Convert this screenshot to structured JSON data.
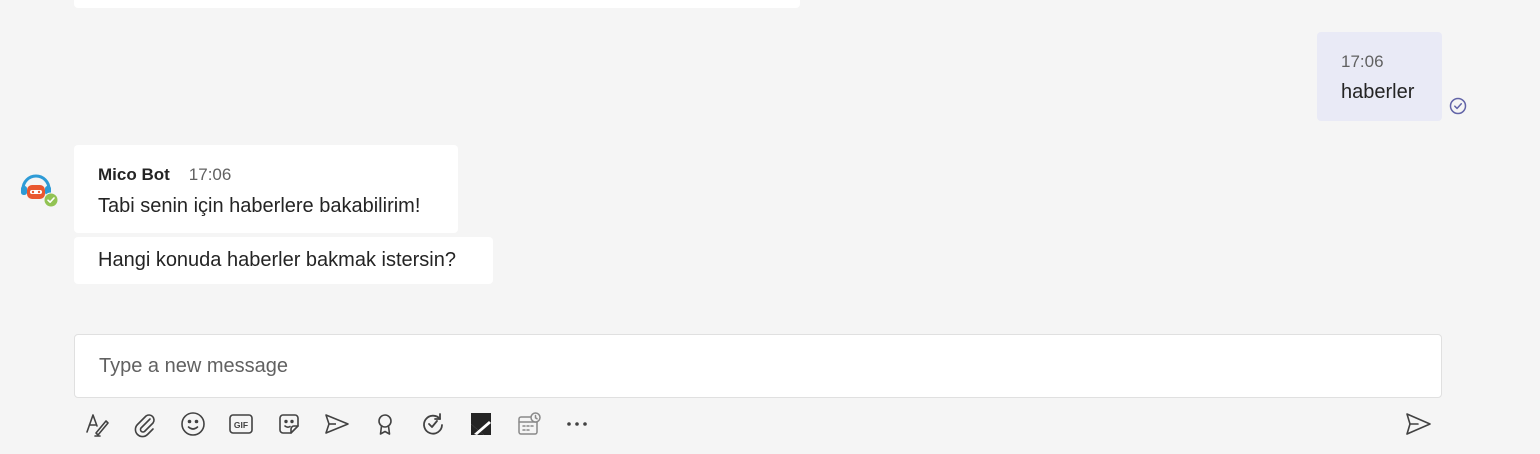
{
  "conversation": {
    "outgoing": {
      "time": "17:06",
      "text": "haberler"
    },
    "bot": {
      "sender": "Mico Bot",
      "time": "17:06",
      "messages": [
        "Tabi senin için haberlere bakabilirim!",
        "Hangi konuda haberler bakmak istersin?"
      ]
    }
  },
  "compose": {
    "placeholder": "Type a new message"
  },
  "toolbar": {
    "icons": [
      "format-icon",
      "attach-icon",
      "emoji-icon",
      "gif-icon",
      "sticker-icon",
      "meet-now-icon",
      "praise-icon",
      "loop-icon",
      "app-icon",
      "schedule-icon",
      "more-icon"
    ],
    "send_icon": "send-icon"
  },
  "colors": {
    "background": "#f5f5f5",
    "outgoing_bubble": "#e9eaf6",
    "incoming_bubble": "#ffffff",
    "accent": "#6264a7",
    "presence_available": "#92c353",
    "avatar_orange": "#e9572f",
    "avatar_blue": "#2e9bd6"
  }
}
